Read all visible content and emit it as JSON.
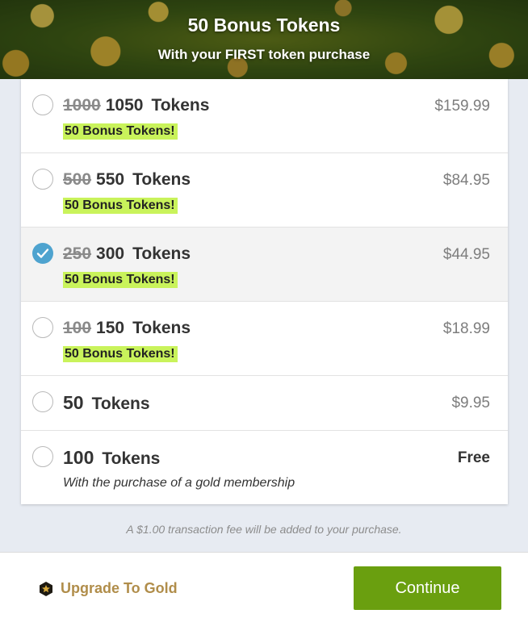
{
  "banner": {
    "title": "50 Bonus Tokens",
    "subtitle": "With your FIRST token purchase"
  },
  "options": [
    {
      "old_count": "1000",
      "count": "1050",
      "unit": "Tokens",
      "bonus": "50 Bonus Tokens!",
      "price": "$159.99",
      "selected": false
    },
    {
      "old_count": "500",
      "count": "550",
      "unit": "Tokens",
      "bonus": "50 Bonus Tokens!",
      "price": "$84.95",
      "selected": false
    },
    {
      "old_count": "250",
      "count": "300",
      "unit": "Tokens",
      "bonus": "50 Bonus Tokens!",
      "price": "$44.95",
      "selected": true
    },
    {
      "old_count": "100",
      "count": "150",
      "unit": "Tokens",
      "bonus": "50 Bonus Tokens!",
      "price": "$18.99",
      "selected": false
    },
    {
      "count": "50",
      "unit": "Tokens",
      "price": "$9.95",
      "selected": false
    },
    {
      "count": "100",
      "unit": "Tokens",
      "price": "Free",
      "note": "With the purchase of a gold membership",
      "selected": false
    }
  ],
  "fee_note": "A $1.00 transaction fee will be added to your purchase.",
  "footer": {
    "upgrade_label": "Upgrade To Gold",
    "continue_label": "Continue"
  },
  "colors": {
    "accent_blue": "#4ea3cf",
    "bonus_highlight": "#c9f35b",
    "continue_green": "#6a9f0f",
    "gold_text": "#b08d4a"
  },
  "icons": {
    "selected_radio": "checkmark-icon",
    "upgrade": "gold-hexagon-icon"
  }
}
